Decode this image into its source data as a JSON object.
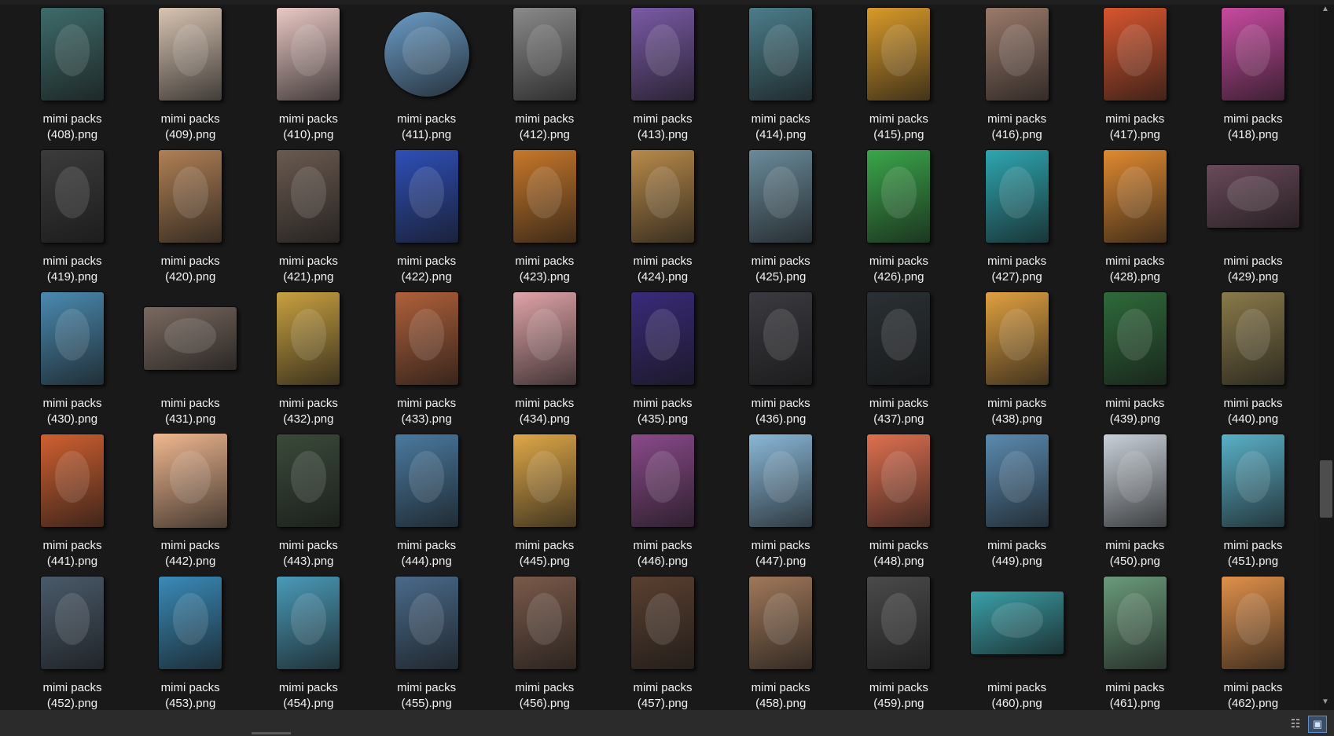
{
  "files": [
    {
      "name": "mimi packs",
      "sub": "(408).png",
      "color": "#3e6b6a",
      "shape": "tall"
    },
    {
      "name": "mimi packs",
      "sub": "(409).png",
      "color": "#d8c4b2",
      "shape": "tall"
    },
    {
      "name": "mimi packs",
      "sub": "(410).png",
      "color": "#e9c8c4",
      "shape": "tall"
    },
    {
      "name": "mimi packs",
      "sub": "(411).png",
      "color": "#6a9cc7",
      "shape": "circle"
    },
    {
      "name": "mimi packs",
      "sub": "(412).png",
      "color": "#8a8a8a",
      "shape": "tall"
    },
    {
      "name": "mimi packs",
      "sub": "(413).png",
      "color": "#7a5aa6",
      "shape": "tall"
    },
    {
      "name": "mimi packs",
      "sub": "(414).png",
      "color": "#4b7d8a",
      "shape": "tall"
    },
    {
      "name": "mimi packs",
      "sub": "(415).png",
      "color": "#d99a2a",
      "shape": "tall"
    },
    {
      "name": "mimi packs",
      "sub": "(416).png",
      "color": "#9a7a6a",
      "shape": "tall"
    },
    {
      "name": "mimi packs",
      "sub": "(417).png",
      "color": "#d8552e",
      "shape": "tall"
    },
    {
      "name": "mimi packs",
      "sub": "(418).png",
      "color": "#c84aa0",
      "shape": "tall"
    },
    {
      "name": "mimi packs",
      "sub": "(419).png",
      "color": "#3b3b3b",
      "shape": "tall"
    },
    {
      "name": "mimi packs",
      "sub": "(420).png",
      "color": "#b08055",
      "shape": "tall"
    },
    {
      "name": "mimi packs",
      "sub": "(421).png",
      "color": "#6a5a50",
      "shape": "tall"
    },
    {
      "name": "mimi packs",
      "sub": "(422).png",
      "color": "#2e4fb8",
      "shape": "tall"
    },
    {
      "name": "mimi packs",
      "sub": "(423).png",
      "color": "#c8782a",
      "shape": "tall"
    },
    {
      "name": "mimi packs",
      "sub": "(424).png",
      "color": "#b88a4a",
      "shape": "tall"
    },
    {
      "name": "mimi packs",
      "sub": "(425).png",
      "color": "#6a8a9a",
      "shape": "tall"
    },
    {
      "name": "mimi packs",
      "sub": "(426).png",
      "color": "#3aa64a",
      "shape": "tall"
    },
    {
      "name": "mimi packs",
      "sub": "(427).png",
      "color": "#2ea6b0",
      "shape": "tall"
    },
    {
      "name": "mimi packs",
      "sub": "(428).png",
      "color": "#e08a30",
      "shape": "tall"
    },
    {
      "name": "mimi packs",
      "sub": "(429).png",
      "color": "#6a4a5a",
      "shape": "wide"
    },
    {
      "name": "mimi packs",
      "sub": "(430).png",
      "color": "#4a8ab0",
      "shape": "tall"
    },
    {
      "name": "mimi packs",
      "sub": "(431).png",
      "color": "#7a6a60",
      "shape": "wide"
    },
    {
      "name": "mimi packs",
      "sub": "(432).png",
      "color": "#c8a040",
      "shape": "tall"
    },
    {
      "name": "mimi packs",
      "sub": "(433).png",
      "color": "#b0603a",
      "shape": "tall"
    },
    {
      "name": "mimi packs",
      "sub": "(434).png",
      "color": "#e0a4a8",
      "shape": "tall"
    },
    {
      "name": "mimi packs",
      "sub": "(435).png",
      "color": "#3a2a7a",
      "shape": "tall"
    },
    {
      "name": "mimi packs",
      "sub": "(436).png",
      "color": "#3a3a40",
      "shape": "tall"
    },
    {
      "name": "mimi packs",
      "sub": "(437).png",
      "color": "#2a3034",
      "shape": "tall"
    },
    {
      "name": "mimi packs",
      "sub": "(438).png",
      "color": "#e0a040",
      "shape": "tall"
    },
    {
      "name": "mimi packs",
      "sub": "(439).png",
      "color": "#2e6a3a",
      "shape": "tall"
    },
    {
      "name": "mimi packs",
      "sub": "(440).png",
      "color": "#8a7a4a",
      "shape": "tall"
    },
    {
      "name": "mimi packs",
      "sub": "(441).png",
      "color": "#d06030",
      "shape": "tall"
    },
    {
      "name": "mimi packs",
      "sub": "(442).png",
      "color": "#f0b890",
      "shape": "square"
    },
    {
      "name": "mimi packs",
      "sub": "(443).png",
      "color": "#3a4a3a",
      "shape": "tall"
    },
    {
      "name": "mimi packs",
      "sub": "(444).png",
      "color": "#4a7aa0",
      "shape": "tall"
    },
    {
      "name": "mimi packs",
      "sub": "(445).png",
      "color": "#e0a848",
      "shape": "tall"
    },
    {
      "name": "mimi packs",
      "sub": "(446).png",
      "color": "#8a4a8a",
      "shape": "tall"
    },
    {
      "name": "mimi packs",
      "sub": "(447).png",
      "color": "#8ab8d8",
      "shape": "tall"
    },
    {
      "name": "mimi packs",
      "sub": "(448).png",
      "color": "#e07050",
      "shape": "tall"
    },
    {
      "name": "mimi packs",
      "sub": "(449).png",
      "color": "#5a8ab0",
      "shape": "tall"
    },
    {
      "name": "mimi packs",
      "sub": "(450).png",
      "color": "#c8d0d8",
      "shape": "tall"
    },
    {
      "name": "mimi packs",
      "sub": "(451).png",
      "color": "#5ab0c8",
      "shape": "tall"
    },
    {
      "name": "mimi packs",
      "sub": "(452).png",
      "color": "#4a5a6a",
      "shape": "tall"
    },
    {
      "name": "mimi packs",
      "sub": "(453).png",
      "color": "#3a8ab8",
      "shape": "tall"
    },
    {
      "name": "mimi packs",
      "sub": "(454).png",
      "color": "#4a9ab8",
      "shape": "tall"
    },
    {
      "name": "mimi packs",
      "sub": "(455).png",
      "color": "#4a6a8a",
      "shape": "tall"
    },
    {
      "name": "mimi packs",
      "sub": "(456).png",
      "color": "#7a5a4a",
      "shape": "tall"
    },
    {
      "name": "mimi packs",
      "sub": "(457).png",
      "color": "#5a4030",
      "shape": "tall"
    },
    {
      "name": "mimi packs",
      "sub": "(458).png",
      "color": "#a0785a",
      "shape": "tall"
    },
    {
      "name": "mimi packs",
      "sub": "(459).png",
      "color": "#4a4a4a",
      "shape": "tall"
    },
    {
      "name": "mimi packs",
      "sub": "(460).png",
      "color": "#3aa0a8",
      "shape": "wide"
    },
    {
      "name": "mimi packs",
      "sub": "(461).png",
      "color": "#6a9a7a",
      "shape": "tall"
    },
    {
      "name": "mimi packs",
      "sub": "(462).png",
      "color": "#e0904a",
      "shape": "tall"
    }
  ],
  "view_buttons": {
    "details_icon": "details-view-icon",
    "icons_icon": "large-icons-view-icon",
    "details_glyph": "☷",
    "icons_glyph": "▣"
  },
  "scrollbar": {
    "up_glyph": "▲",
    "down_glyph": "▼"
  }
}
